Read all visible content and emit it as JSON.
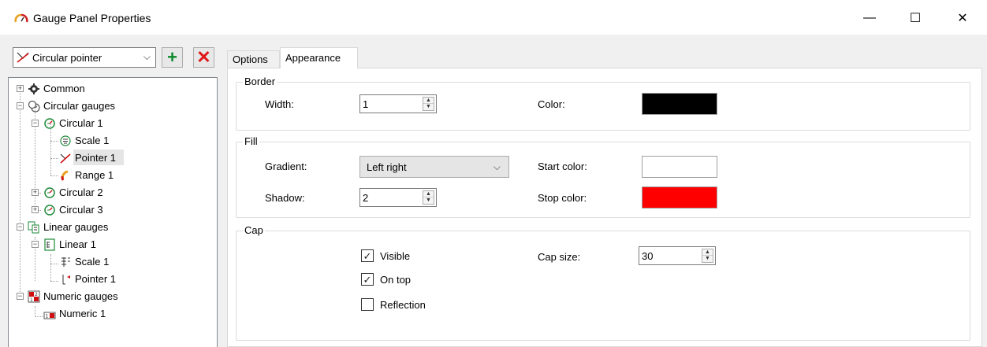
{
  "window": {
    "title": "Gauge Panel Properties",
    "minimize_glyph": "—",
    "maximize_glyph": "☐",
    "close_glyph": "✕"
  },
  "left": {
    "object_combo": {
      "value": "Circular pointer",
      "icon": "circular-pointer-icon"
    },
    "add_glyph": "+",
    "delete_glyph": "✕",
    "tree": {
      "common": "Common",
      "circular_gauges": "Circular gauges",
      "circular1": "Circular 1",
      "scale1": "Scale 1",
      "pointer1": "Pointer 1",
      "range1": "Range 1",
      "circular2": "Circular 2",
      "circular3": "Circular 3",
      "linear_gauges": "Linear gauges",
      "linear1": "Linear 1",
      "linear_scale1": "Scale 1",
      "linear_pointer1": "Pointer 1",
      "numeric_gauges": "Numeric gauges",
      "numeric1": "Numeric 1"
    }
  },
  "tabs": {
    "options": "Options",
    "appearance": "Appearance"
  },
  "border": {
    "title": "Border",
    "width_label": "Width:",
    "width_value": "1",
    "color_label": "Color:",
    "color_value": "#000000"
  },
  "fill": {
    "title": "Fill",
    "gradient_label": "Gradient:",
    "gradient_value": "Left right",
    "shadow_label": "Shadow:",
    "shadow_value": "2",
    "start_color_label": "Start color:",
    "start_color_value": "#ffffff",
    "stop_color_label": "Stop color:",
    "stop_color_value": "#ff0000"
  },
  "cap": {
    "title": "Cap",
    "visible_label": "Visible",
    "visible_checked": true,
    "on_top_label": "On top",
    "on_top_checked": true,
    "reflection_label": "Reflection",
    "reflection_checked": false,
    "cap_size_label": "Cap size:",
    "cap_size_value": "30"
  },
  "colors": {
    "add_green": "#0a8a2a",
    "delete_red": "#e01818",
    "tree_green": "#1e8a3a"
  }
}
